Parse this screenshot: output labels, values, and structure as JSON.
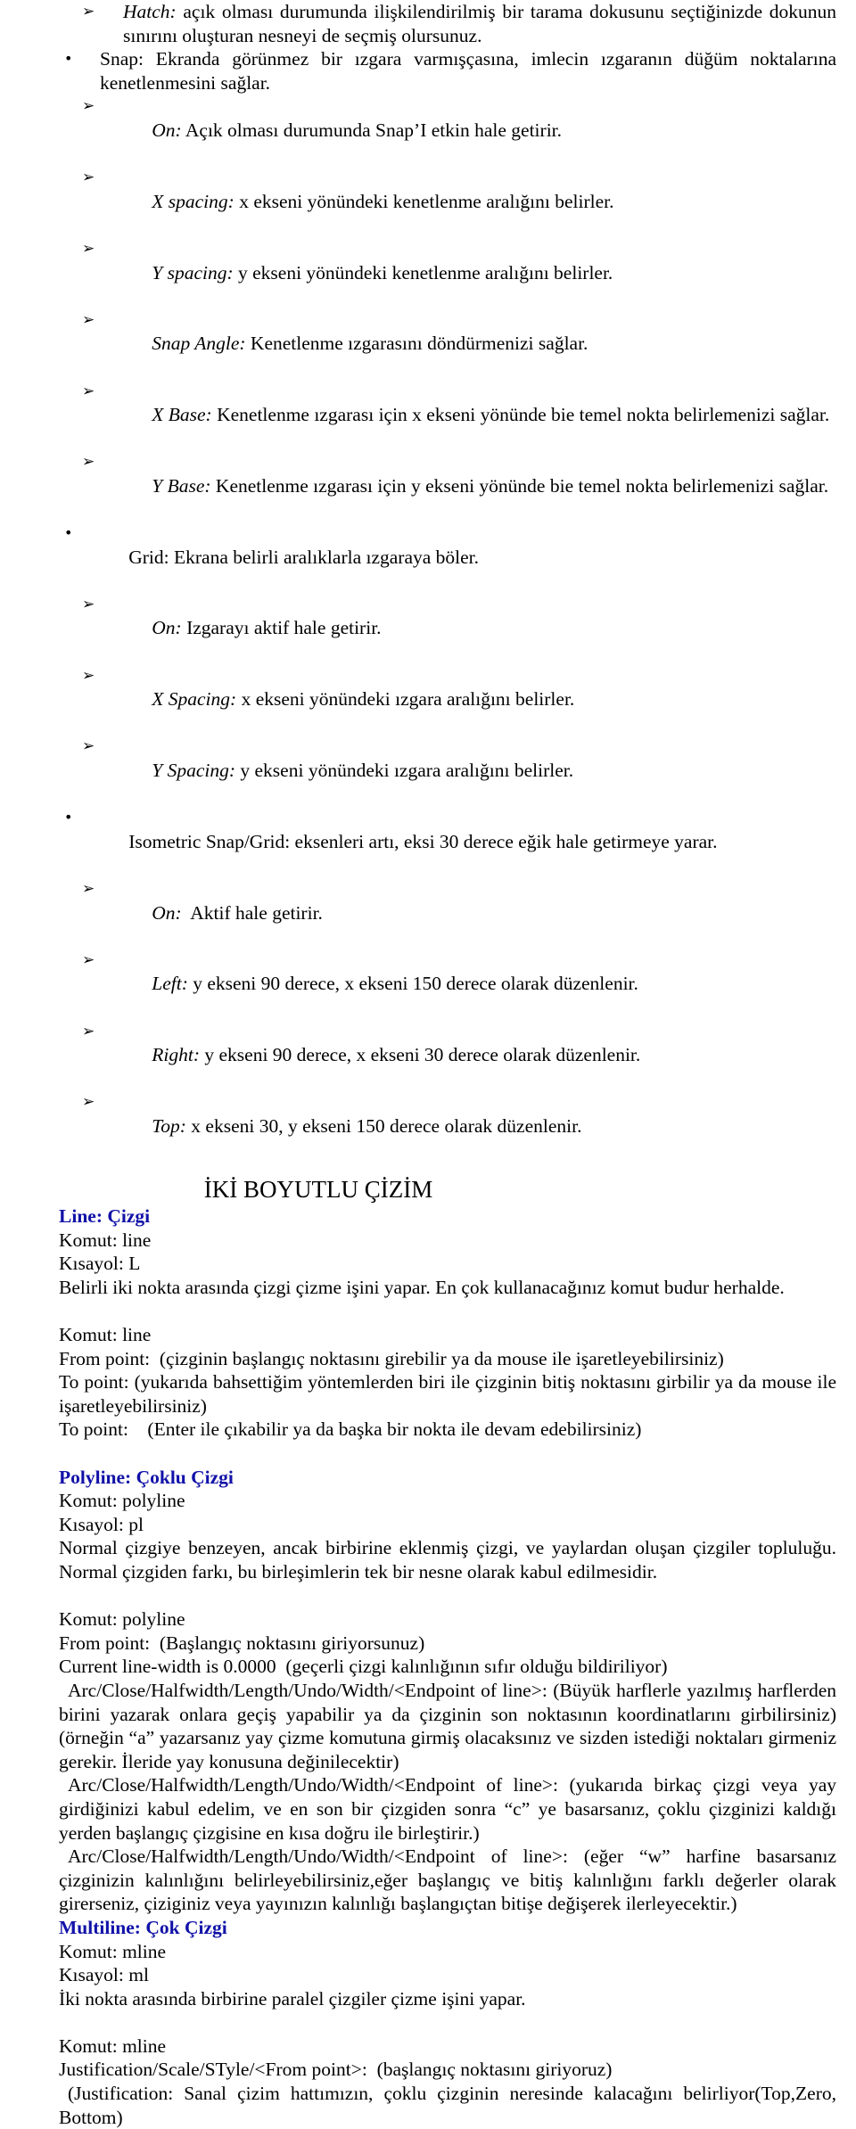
{
  "document": {
    "language": "tr",
    "accent_color": "#1111A8",
    "text_color": "#000000",
    "background_color": "#FFFFFF"
  },
  "bullets": [
    {
      "level": 2,
      "marker": "arrowhead-bullet",
      "term": "Hatch:",
      "text": " açık olması durumunda ilişkilendirilmiş bir tarama dokusunu seçtiğinizde dokunun sınırını oluşturan nesneyi de seçmiş olursunuz."
    },
    {
      "level": 1,
      "marker": "round-bullet",
      "term": "",
      "text": "Snap: Ekranda görünmez bir ızgara varmışçasına, imlecin ızgaranın düğüm noktalarına kenetlenmesini sağlar."
    },
    {
      "level": 2,
      "marker": "arrowhead-bullet",
      "term": "On:",
      "text": " Açık olması durumunda Snap’I etkin hale getirir."
    },
    {
      "level": 2,
      "marker": "arrowhead-bullet",
      "term": "X spacing:",
      "text": " x ekseni yönündeki kenetlenme aralığını belirler."
    },
    {
      "level": 2,
      "marker": "arrowhead-bullet",
      "term": "Y spacing:",
      "text": " y ekseni yönündeki kenetlenme aralığını belirler."
    },
    {
      "level": 2,
      "marker": "arrowhead-bullet",
      "term": "Snap Angle:",
      "text": " Kenetlenme ızgarasını döndürmenizi sağlar."
    },
    {
      "level": 2,
      "marker": "arrowhead-bullet",
      "term": "X Base:",
      "text": " Kenetlenme ızgarası için x ekseni yönünde bie temel nokta belirlemenizi sağlar."
    },
    {
      "level": 2,
      "marker": "arrowhead-bullet",
      "term": "Y Base:",
      "text": " Kenetlenme ızgarası için y ekseni yönünde bie temel nokta belirlemenizi sağlar."
    },
    {
      "level": 1,
      "marker": "round-bullet",
      "term": "",
      "text": "Grid: Ekrana belirli aralıklarla ızgaraya böler."
    },
    {
      "level": 2,
      "marker": "arrowhead-bullet",
      "term": "On:",
      "text": " Izgarayı aktif hale getirir."
    },
    {
      "level": 2,
      "marker": "arrowhead-bullet",
      "term": "X Spacing:",
      "text": " x ekseni yönündeki ızgara aralığını belirler."
    },
    {
      "level": 2,
      "marker": "arrowhead-bullet",
      "term": "Y Spacing:",
      "text": " y ekseni yönündeki ızgara aralığını belirler."
    },
    {
      "level": 1,
      "marker": "round-bullet",
      "term": "",
      "text": "Isometric Snap/Grid: eksenleri artı, eksi 30 derece eğik hale getirmeye yarar."
    },
    {
      "level": 2,
      "marker": "arrowhead-bullet",
      "term": "On:",
      "text": "  Aktif hale getirir."
    },
    {
      "level": 2,
      "marker": "arrowhead-bullet",
      "term": "Left:",
      "text": " y ekseni 90 derece, x ekseni 150 derece olarak düzenlenir."
    },
    {
      "level": 2,
      "marker": "arrowhead-bullet",
      "term": "Right:",
      "text": " y ekseni 90 derece, x ekseni 30 derece olarak düzenlenir."
    },
    {
      "level": 2,
      "marker": "arrowhead-bullet",
      "term": "Top:",
      "text": " x ekseni 30, y ekseni 150 derece olarak düzenlenir."
    }
  ],
  "section_title": "İKİ BOYUTLU ÇİZİM",
  "line_section": {
    "heading": "Line: Çizgi",
    "command_label": "Komut: line",
    "shortcut_label": "Kısayol: L",
    "description": "Belirli iki nokta arasında çizgi çizme işini yapar. En çok kullanacağınız komut budur herhalde.",
    "prompt_command": "Komut: line",
    "prompt_from": "From point:  (çizginin başlangıç noktasını girebilir ya da mouse ile işaretleyebilirsiniz)",
    "prompt_to_1": "To point:    (yukarıda bahsettiğim yöntemlerden biri ile çizginin bitiş noktasını girbilir ya da mouse ile işaretleyebilirsiniz)",
    "prompt_to_2": "To point:    (Enter ile çıkabilir ya da başka bir nokta ile devam edebilirsiniz)"
  },
  "polyline_section": {
    "heading": "Polyline: Çoklu Çizgi",
    "command_label": "Komut: polyline",
    "shortcut_label": "Kısayol: pl",
    "description": "Normal çizgiye benzeyen, ancak birbirine eklenmiş çizgi, ve yaylardan oluşan çizgiler topluluğu. Normal çizgiden farkı, bu birleşimlerin tek bir nesne olarak kabul edilmesidir.",
    "prompt_command": "Komut: polyline",
    "prompt_from": "From point:  (Başlangıç noktasını giriyorsunuz)",
    "prompt_linewidth": "Current line-width is 0.0000  (geçerli çizgi kalınlığının sıfır olduğu bildiriliyor)",
    "prompt_arc_1": "Arc/Close/Halfwidth/Length/Undo/Width/<Endpoint of line>:    (Büyük harflerle yazılmış harflerden birini yazarak onlara geçiş yapabilir ya da çizginin son noktasının koordinatlarını girbilirsiniz)(örneğin “a” yazarsanız yay çizme komutuna girmiş olacaksınız ve sizden istediği noktaları girmeniz gerekir. İleride yay konusuna değinilecektir)",
    "prompt_arc_2": "Arc/Close/Halfwidth/Length/Undo/Width/<Endpoint of line>: (yukarıda birkaç çizgi veya yay girdiğinizi kabul edelim, ve en son bir çizgiden sonra “c” ye basarsanız, çoklu çizginizi kaldığı yerden başlangıç çizgisine en kısa doğru ile birleştirir.)",
    "prompt_arc_3": "Arc/Close/Halfwidth/Length/Undo/Width/<Endpoint of line>:  (eğer “w” harfine basarsanız çizginizin kalınlığını belirleyebilirsiniz,eğer başlangıç ve bitiş kalınlığını farklı değerler olarak girerseniz, çiziginiz veya yayınızın kalınlığı başlangıçtan bitişe değişerek ilerleyecektir.)"
  },
  "multiline_section": {
    "heading": "Multiline: Çok Çizgi",
    "command_label": "Komut: mline",
    "shortcut_label": "Kısayol: ml",
    "description": "İki nokta arasında birbirine paralel çizgiler çizme işini yapar.",
    "prompt_command": "Komut: mline",
    "prompt_justification": "Justification/Scale/STyle/<From point>:  (başlangıç noktasını giriyoruz)",
    "prompt_justification_note": "(Justification: Sanal çizim hattımızın, çoklu çizginin neresinde kalacağını belirliyor(Top,Zero, Bottom)"
  },
  "icons": {
    "round_bullet": "•",
    "arrow_bullet": "➢"
  }
}
